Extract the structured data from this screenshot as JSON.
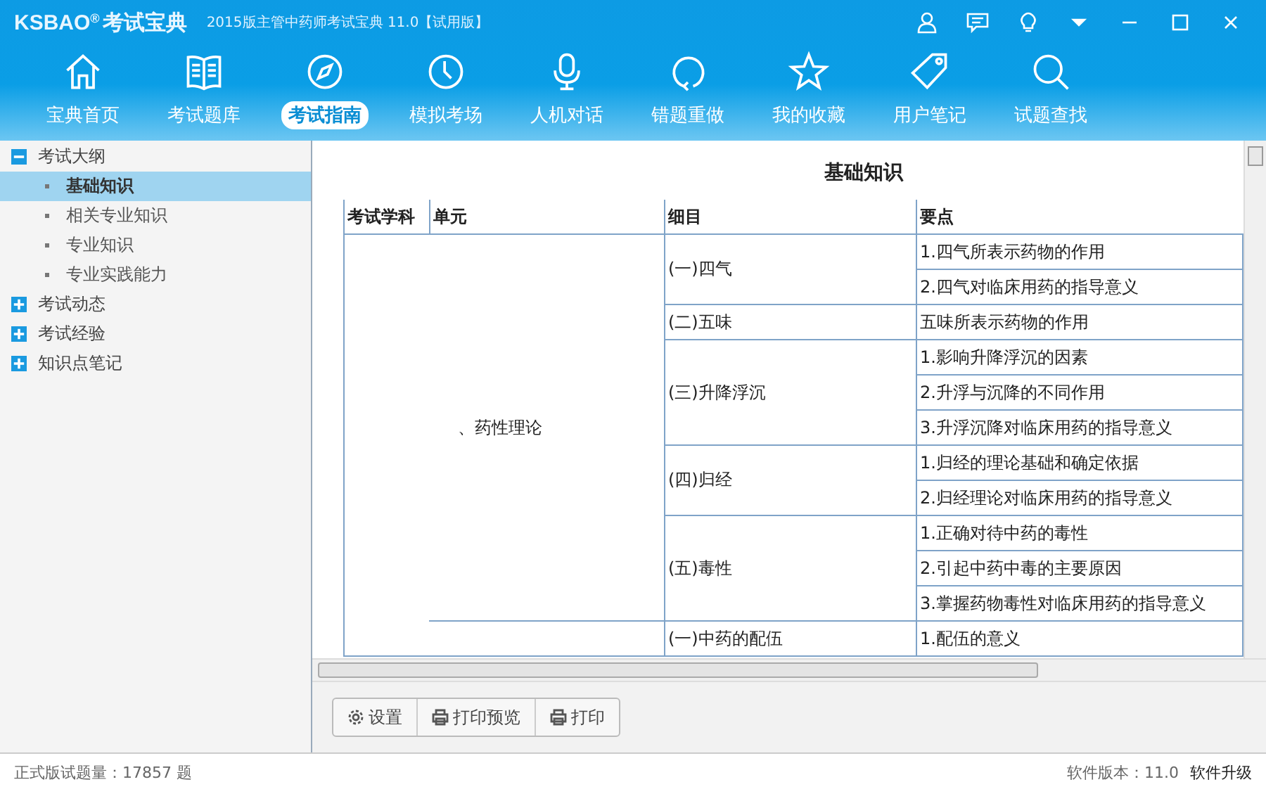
{
  "window": {
    "logo": "KSBAO",
    "logo_mark": "®",
    "logo_text": "考试宝典",
    "title": "2015版主管中药师考试宝典 11.0【试用版】"
  },
  "nav": [
    {
      "label": "宝典首页",
      "selected": false
    },
    {
      "label": "考试题库",
      "selected": false
    },
    {
      "label": "考试指南",
      "selected": true
    },
    {
      "label": "模拟考场",
      "selected": false
    },
    {
      "label": "人机对话",
      "selected": false
    },
    {
      "label": "错题重做",
      "selected": false
    },
    {
      "label": "我的收藏",
      "selected": false
    },
    {
      "label": "用户笔记",
      "selected": false
    },
    {
      "label": "试题查找",
      "selected": false
    }
  ],
  "sidebar": {
    "items": [
      {
        "label": "考试大纲",
        "expanded": true,
        "children": [
          {
            "label": "基础知识",
            "selected": true
          },
          {
            "label": "相关专业知识",
            "selected": false
          },
          {
            "label": "专业知识",
            "selected": false
          },
          {
            "label": "专业实践能力",
            "selected": false
          }
        ]
      },
      {
        "label": "考试动态",
        "expanded": false
      },
      {
        "label": "考试经验",
        "expanded": false
      },
      {
        "label": "知识点笔记",
        "expanded": false
      }
    ]
  },
  "document": {
    "title": "基础知识",
    "columns": [
      "考试学科",
      "单元",
      "细目",
      "要点"
    ],
    "units": [
      {
        "name": "、药性理论",
        "items": [
          {
            "name": "(一)四气",
            "points": [
              "1.四气所表示药物的作用",
              "2.四气对临床用药的指导意义"
            ]
          },
          {
            "name": "(二)五味",
            "points": [
              "五味所表示药物的作用"
            ]
          },
          {
            "name": "(三)升降浮沉",
            "points": [
              "1.影响升降浮沉的因素",
              "2.升浮与沉降的不同作用",
              "3.升浮沉降对临床用药的指导意义"
            ]
          },
          {
            "name": "(四)归经",
            "points": [
              "1.归经的理论基础和确定依据",
              "2.归经理论对临床用药的指导意义"
            ]
          },
          {
            "name": "(五)毒性",
            "points": [
              "1.正确对待中药的毒性",
              "2.引起中药中毒的主要原因",
              "3.掌握药物毒性对临床用药的指导意义"
            ]
          }
        ]
      },
      {
        "items": [
          {
            "name": "(一)中药的配伍",
            "points": [
              "1.配伍的意义"
            ]
          }
        ]
      }
    ]
  },
  "toolbar": [
    {
      "label": "设置"
    },
    {
      "label": "打印预览"
    },
    {
      "label": "打印"
    }
  ],
  "status_bar": {
    "question_count": "正式版试题量：17857 题",
    "version": "软件版本：11.0",
    "upgrade": "软件升级"
  }
}
